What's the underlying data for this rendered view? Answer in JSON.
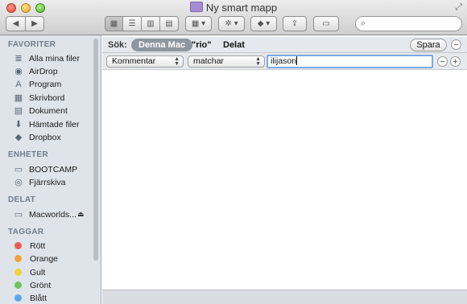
{
  "window": {
    "title": "Ny smart mapp",
    "folder_icon": "smart-folder-icon"
  },
  "toolbar": {
    "back_icon": "◀",
    "forward_icon": "▶",
    "view_icons": [
      "▦",
      "☰",
      "▥",
      "▤"
    ],
    "arrange_icon": "▦ ▾",
    "action_icon": "✲ ▾",
    "dropbox_icon": "◆ ▾",
    "share_icon": "⇪",
    "tag_icon": "▭",
    "search_placeholder": "",
    "search_icon": "⌕"
  },
  "sidebar": {
    "favorites_header": "FAVORITER",
    "favorites": [
      {
        "label": "Alla mina filer",
        "icon": "≣"
      },
      {
        "label": "AirDrop",
        "icon": "◉"
      },
      {
        "label": "Program",
        "icon": "A"
      },
      {
        "label": "Skrivbord",
        "icon": "▦"
      },
      {
        "label": "Dokument",
        "icon": "▤"
      },
      {
        "label": "Hämtade filer",
        "icon": "⬇"
      },
      {
        "label": "Dropbox",
        "icon": "◆"
      }
    ],
    "devices_header": "ENHETER",
    "devices": [
      {
        "label": "BOOTCAMP",
        "icon": "▭"
      },
      {
        "label": "Fjärrskiva",
        "icon": "◎"
      }
    ],
    "shared_header": "DELAT",
    "shared": [
      {
        "label": "Macworlds...",
        "icon": "▭",
        "eject": "⏏"
      }
    ],
    "tags_header": "TAGGAR",
    "tags": [
      {
        "label": "Rött",
        "color": "#e85d55"
      },
      {
        "label": "Orange",
        "color": "#f0a33a"
      },
      {
        "label": "Gult",
        "color": "#f3d13b"
      },
      {
        "label": "Grönt",
        "color": "#6cc45a"
      },
      {
        "label": "Blått",
        "color": "#5aa8ea"
      }
    ]
  },
  "search_scope": {
    "label": "Sök:",
    "this_mac": "Denna Mac",
    "rio": "\"rio\"",
    "shared": "Delat",
    "save": "Spara",
    "remove": "−"
  },
  "criteria": {
    "attribute": "Kommentar",
    "operator": "matchar",
    "value": "ilijason",
    "remove": "−",
    "add": "+"
  }
}
